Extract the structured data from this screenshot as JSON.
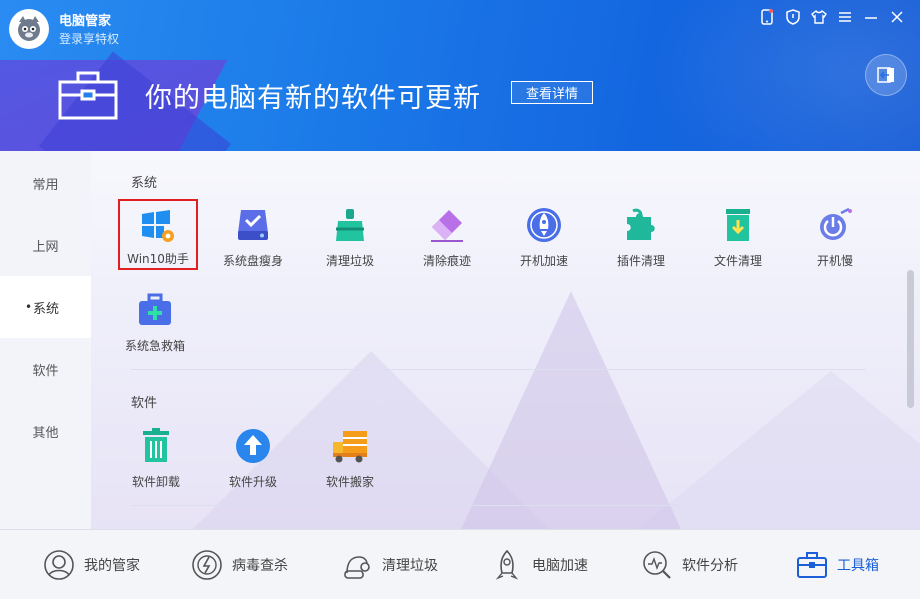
{
  "app": {
    "title": "电脑管家",
    "login_link": "登录享特权"
  },
  "window_controls": [
    "phone-icon",
    "shield-icon",
    "shirt-icon",
    "menu-icon",
    "minimize-icon",
    "close-icon"
  ],
  "banner": {
    "headline": "你的电脑有新的软件可更新",
    "details_button": "查看详情"
  },
  "sidebar": {
    "items": [
      {
        "label": "常用",
        "active": false
      },
      {
        "label": "上网",
        "active": false
      },
      {
        "label": "系统",
        "active": true
      },
      {
        "label": "软件",
        "active": false
      },
      {
        "label": "其他",
        "active": false
      }
    ]
  },
  "sections": {
    "system": {
      "title": "系统",
      "tools": [
        {
          "label": "Win10助手",
          "icon": "windows-gear-icon",
          "selected": true
        },
        {
          "label": "系统盘瘦身",
          "icon": "disk-icon"
        },
        {
          "label": "清理垃圾",
          "icon": "broom-icon"
        },
        {
          "label": "清除痕迹",
          "icon": "eraser-icon"
        },
        {
          "label": "开机加速",
          "icon": "rocket-icon"
        },
        {
          "label": "插件清理",
          "icon": "puzzle-icon"
        },
        {
          "label": "文件清理",
          "icon": "trash-file-icon"
        },
        {
          "label": "开机慢",
          "icon": "power-slow-icon"
        },
        {
          "label": "系统急救箱",
          "icon": "first-aid-icon"
        }
      ]
    },
    "software": {
      "title": "软件",
      "tools": [
        {
          "label": "软件卸载",
          "icon": "trash-icon"
        },
        {
          "label": "软件升级",
          "icon": "upgrade-icon"
        },
        {
          "label": "软件搬家",
          "icon": "truck-icon"
        }
      ]
    }
  },
  "bottom_nav": [
    {
      "label": "我的管家",
      "icon": "avatar-icon",
      "active": false
    },
    {
      "label": "病毒查杀",
      "icon": "virus-scan-icon",
      "active": false
    },
    {
      "label": "清理垃圾",
      "icon": "vacuum-icon",
      "active": false
    },
    {
      "label": "电脑加速",
      "icon": "rocket-icon",
      "active": false
    },
    {
      "label": "软件分析",
      "icon": "analysis-icon",
      "active": false
    },
    {
      "label": "工具箱",
      "icon": "toolbox-icon",
      "active": true
    }
  ],
  "colors": {
    "header_blue": "#1c7be8",
    "accent_blue": "#1a5fd8",
    "selection_red": "#e02020"
  }
}
